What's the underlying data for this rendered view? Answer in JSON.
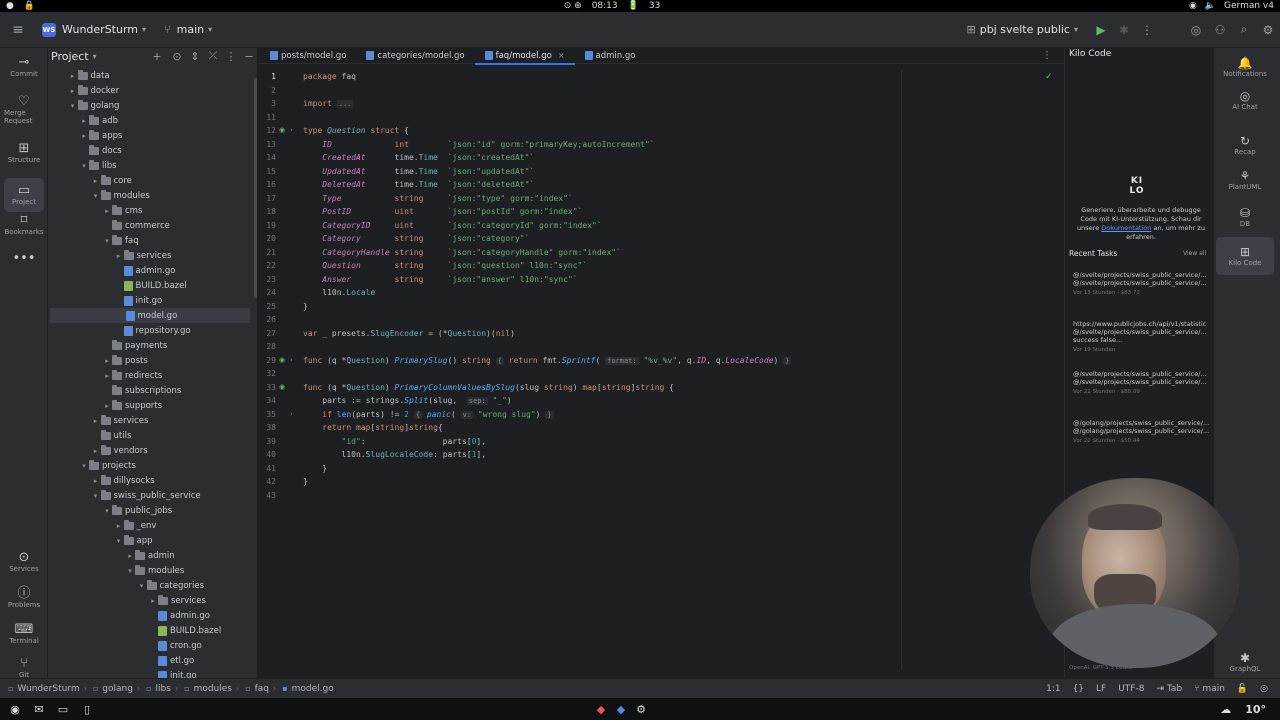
{
  "system_bar": {
    "status_icons": "⊙ ⊕",
    "time": "08:13",
    "battery": "33",
    "keyboard": "German v4"
  },
  "topbar": {
    "project_badge": "WS",
    "project_name": "WunderSturm",
    "branch": "main",
    "run_config": "pbj svelte public"
  },
  "left_strip": [
    {
      "label": "Commit",
      "icon": "commit-icon",
      "glyph": "⊸"
    },
    {
      "label": "Merge Request",
      "icon": "merge-request-icon",
      "glyph": "♡"
    },
    {
      "label": "Structure",
      "icon": "structure-icon",
      "glyph": "⊞"
    },
    {
      "label": "Project",
      "icon": "folder-icon",
      "glyph": "▭"
    },
    {
      "label": "Bookmarks",
      "icon": "bookmark-icon",
      "glyph": "⌑"
    },
    {
      "label": "",
      "icon": "more-icon",
      "glyph": "•••"
    },
    {
      "label": "Services",
      "icon": "services-icon",
      "glyph": "⊙"
    },
    {
      "label": "Problems",
      "icon": "problems-icon",
      "glyph": "ⓘ"
    },
    {
      "label": "Terminal",
      "icon": "terminal-icon",
      "glyph": "⌨"
    },
    {
      "label": "Git",
      "icon": "git-icon",
      "glyph": "⑂"
    }
  ],
  "project_panel": {
    "title": "Project"
  },
  "tree": [
    {
      "name": "data",
      "indent": 1,
      "kind": "folder",
      "open": false
    },
    {
      "name": "docker",
      "indent": 1,
      "kind": "folder",
      "open": false
    },
    {
      "name": "golang",
      "indent": 1,
      "kind": "folder",
      "open": true
    },
    {
      "name": "adb",
      "indent": 2,
      "kind": "folder",
      "open": false
    },
    {
      "name": "apps",
      "indent": 2,
      "kind": "folder",
      "open": false
    },
    {
      "name": "docs",
      "indent": 2,
      "kind": "folder",
      "open": null
    },
    {
      "name": "libs",
      "indent": 2,
      "kind": "folder",
      "open": true
    },
    {
      "name": "core",
      "indent": 3,
      "kind": "folder",
      "open": false
    },
    {
      "name": "modules",
      "indent": 3,
      "kind": "folder",
      "open": true
    },
    {
      "name": "cms",
      "indent": 4,
      "kind": "folder",
      "open": false
    },
    {
      "name": "commerce",
      "indent": 4,
      "kind": "folder",
      "open": null
    },
    {
      "name": "faq",
      "indent": 4,
      "kind": "folder",
      "open": true
    },
    {
      "name": "services",
      "indent": 5,
      "kind": "folder",
      "open": false
    },
    {
      "name": "admin.go",
      "indent": 5,
      "kind": "go"
    },
    {
      "name": "BUILD.bazel",
      "indent": 5,
      "kind": "bazel"
    },
    {
      "name": "init.go",
      "indent": 5,
      "kind": "go"
    },
    {
      "name": "model.go",
      "indent": 5,
      "kind": "go",
      "selected": true
    },
    {
      "name": "repository.go",
      "indent": 5,
      "kind": "go"
    },
    {
      "name": "payments",
      "indent": 4,
      "kind": "folder",
      "open": null
    },
    {
      "name": "posts",
      "indent": 4,
      "kind": "folder",
      "open": false
    },
    {
      "name": "redirects",
      "indent": 4,
      "kind": "folder",
      "open": false
    },
    {
      "name": "subscriptions",
      "indent": 4,
      "kind": "folder",
      "open": null
    },
    {
      "name": "supports",
      "indent": 4,
      "kind": "folder",
      "open": false
    },
    {
      "name": "services",
      "indent": 3,
      "kind": "folder",
      "open": false
    },
    {
      "name": "utils",
      "indent": 3,
      "kind": "folder",
      "open": null
    },
    {
      "name": "vendors",
      "indent": 3,
      "kind": "folder",
      "open": false
    },
    {
      "name": "projects",
      "indent": 2,
      "kind": "folder",
      "open": true
    },
    {
      "name": "dillysocks",
      "indent": 3,
      "kind": "folder",
      "open": false
    },
    {
      "name": "swiss_public_service",
      "indent": 3,
      "kind": "folder",
      "open": true
    },
    {
      "name": "public_jobs",
      "indent": 4,
      "kind": "folder",
      "open": true
    },
    {
      "name": "_env",
      "indent": 5,
      "kind": "folder",
      "open": false
    },
    {
      "name": "app",
      "indent": 5,
      "kind": "folder",
      "open": true
    },
    {
      "name": "admin",
      "indent": 6,
      "kind": "folder",
      "open": false
    },
    {
      "name": "modules",
      "indent": 6,
      "kind": "folder",
      "open": true
    },
    {
      "name": "categories",
      "indent": 7,
      "kind": "folder",
      "open": true
    },
    {
      "name": "services",
      "indent": 8,
      "kind": "folder",
      "open": false
    },
    {
      "name": "admin.go",
      "indent": 8,
      "kind": "go"
    },
    {
      "name": "BUILD.bazel",
      "indent": 8,
      "kind": "bazel"
    },
    {
      "name": "cron.go",
      "indent": 8,
      "kind": "go"
    },
    {
      "name": "etl.go",
      "indent": 8,
      "kind": "go"
    },
    {
      "name": "init.go",
      "indent": 8,
      "kind": "go"
    }
  ],
  "tabs": [
    {
      "label": "posts/model.go",
      "active": false
    },
    {
      "label": "categories/model.go",
      "active": false
    },
    {
      "label": "faq/model.go",
      "active": true
    },
    {
      "label": "admin.go",
      "active": false
    }
  ],
  "code_lines": [
    {
      "n": "1",
      "html": "<span class='kw'>package</span> faq"
    },
    {
      "n": "2",
      "html": ""
    },
    {
      "n": "3",
      "html": "<span class='kw'>import</span> <span class='hint'>...</span>"
    },
    {
      "n": "11",
      "html": ""
    },
    {
      "n": "12",
      "html": "<span class='kw'>type</span> <span class='ty'><i>Question</i></span> <span class='kw'>struct</span> {"
    },
    {
      "n": "13",
      "html": "    <span class='fld'>ID</span>             <span class='kw'>int</span>        <span class='str'>`json:\"id\" gorm:\"primaryKey;autoIncrement\"`</span>"
    },
    {
      "n": "14",
      "html": "    <span class='fld'>CreatedAt</span>      time.<span class='ty'>Time</span>  <span class='str'>`json:\"createdAt\"`</span>"
    },
    {
      "n": "15",
      "html": "    <span class='fld'>UpdatedAt</span>      time.<span class='ty'>Time</span>  <span class='str'>`json:\"updatedAt\"`</span>"
    },
    {
      "n": "16",
      "html": "    <span class='fld'>DeletedAt</span>      time.<span class='ty'>Time</span>  <span class='str'>`json:\"deletedAt\"`</span>"
    },
    {
      "n": "17",
      "html": "    <span class='fld'>Type</span>           <span class='kw'>string</span>     <span class='str'>`json:\"type\" gorm:\"index\"`</span>"
    },
    {
      "n": "18",
      "html": "    <span class='fld'>PostID</span>         <span class='kw'>uint</span>       <span class='str'>`json:\"postId\" gorm:\"index\"`</span>"
    },
    {
      "n": "19",
      "html": "    <span class='fld'>CategoryID</span>     <span class='kw'>uint</span>       <span class='str'>`json:\"categoryId\" gorm:\"index\"`</span>"
    },
    {
      "n": "20",
      "html": "    <span class='fld'>Category</span>       <span class='kw'>string</span>     <span class='str'>`json:\"category\"`</span>"
    },
    {
      "n": "21",
      "html": "    <span class='fld'>CategoryHandle</span> <span class='kw'>string</span>     <span class='str'>`json:\"categoryHandle\" gorm:\"index\"`</span>"
    },
    {
      "n": "22",
      "html": "    <span class='fld'>Question</span>       <span class='kw'>string</span>     <span class='str'>`json:\"question\" l10n:\"sync\"`</span>"
    },
    {
      "n": "23",
      "html": "    <span class='fld'>Answer</span>         <span class='kw'>string</span>     <span class='str'>`json:\"answer\" l10n:\"sync\"`</span>"
    },
    {
      "n": "24",
      "html": "    l10n.<span class='ty'>Locale</span>"
    },
    {
      "n": "25",
      "html": "}"
    },
    {
      "n": "26",
      "html": ""
    },
    {
      "n": "27",
      "html": "<span class='kw'>var</span> _ presets.<span class='ty'>SlugEncoder</span> = (*<span class='ty'>Question</span>)(<span class='kw'>nil</span>)"
    },
    {
      "n": "28",
      "html": ""
    },
    {
      "n": "29",
      "html": "<span class='kw'>func</span> (q *<span class='ty'>Question</span>) <span class='fn'>PrimarySlug</span>() <span class='kw'>string</span> <span class='hint'>{</span> <span class='kw'>return</span> fmt.<span class='fn'>Sprintf</span>( <span class='hint'>format:</span> <span class='str'>\"%v_%v\"</span>, q.<span class='fld'>ID</span>, q.<span class='fld'>LocaleCode</span>) <span class='hint'>}</span>"
    },
    {
      "n": "32",
      "html": ""
    },
    {
      "n": "33",
      "html": "<span class='kw'>func</span> (q *<span class='ty'>Question</span>) <span class='fn'>PrimaryColumnValuesBySlug</span>(slug <span class='kw'>string</span>) <span class='kw'>map</span>[<span class='kw'>string</span>]<span class='kw'>string</span> {"
    },
    {
      "n": "34",
      "html": "    parts := strings.<span class='fn'>Split</span>(slug,  <span class='hint'>sep:</span> <span class='str'>\"_\"</span>)"
    },
    {
      "n": "35",
      "html": "    <span class='kw'>if</span> <span class='pl'>len</span>(parts) != <span class='num'>2</span> <span class='hint'>{</span> <span class='fn'>panic</span>( <span class='hint'>v:</span> <span class='str'>\"wrong slug\"</span>) <span class='hint'>}</span>"
    },
    {
      "n": "38",
      "html": "    <span class='kw'>return</span> <span class='kw'>map</span>[<span class='kw'>string</span>]<span class='kw'>string</span>{"
    },
    {
      "n": "39",
      "html": "        <span class='str'>\"id\"</span>:                parts[<span class='num'>0</span>],"
    },
    {
      "n": "40",
      "html": "        l10n.<span class='ty'>SlugLocaleCode</span>: parts[<span class='num'>1</span>],"
    },
    {
      "n": "41",
      "html": "    }"
    },
    {
      "n": "42",
      "html": "}"
    },
    {
      "n": "43",
      "html": ""
    }
  ],
  "kilo": {
    "title": "Kilo Code",
    "logo": "KI LO",
    "intro_text": "Generiere, überarbeite und debugge Code mit KI-Unterstützung. Schau dir unsere",
    "intro_link": "Dokumentation",
    "intro_tail": "an, um mehr zu erfahren.",
    "recent_title": "Recent Tasks",
    "view_all": "View all",
    "tasks": [
      {
        "text": "@/svelte/projects/swiss_public_service/... @/svelte/projects/swiss_public_service/...",
        "meta": "Vor 13 Stunden · $83.72"
      },
      {
        "text": "https://www.publicjobs.ch/api/v1/statistic @/svelte/projects/swiss_public_service/... success false...",
        "meta": "Vor 19 Stunden"
      },
      {
        "text": "@/svelte/projects/swiss_public_service/... @/svelte/projects/swiss_public_service/...",
        "meta": "Vor 21 Stunden · $80.09"
      },
      {
        "text": "@/golang/projects/swiss_public_service/... @/golang/projects/swiss_public_service/...",
        "meta": "Vor 22 Stunden · $50.44"
      }
    ],
    "model": "OpenAI: GPT-5.3 Codex"
  },
  "right_strip": [
    {
      "label": "Notifications",
      "glyph": "🔔",
      "icon": "notifications-icon"
    },
    {
      "label": "AI Chat",
      "glyph": "◎",
      "icon": "ai-chat-icon"
    },
    {
      "label": "Recap",
      "glyph": "↻",
      "icon": "recap-icon"
    },
    {
      "label": "PlantUML",
      "glyph": "⚘",
      "icon": "plantuml-icon"
    },
    {
      "label": "DB",
      "glyph": "⛁",
      "icon": "database-icon"
    },
    {
      "label": "Kilo Code",
      "glyph": "⊞",
      "icon": "kilo-code-icon"
    },
    {
      "label": "GraphQL",
      "glyph": "✱",
      "icon": "graphql-icon"
    }
  ],
  "status": {
    "breadcrumbs": [
      "WunderSturm",
      "golang",
      "libs",
      "modules",
      "faq",
      "model.go"
    ],
    "position": "1:1",
    "line_ending": "LF",
    "encoding": "UTF-8",
    "indent": "Tab",
    "branch": "main"
  },
  "taskbar": {
    "temperature": "10°"
  }
}
